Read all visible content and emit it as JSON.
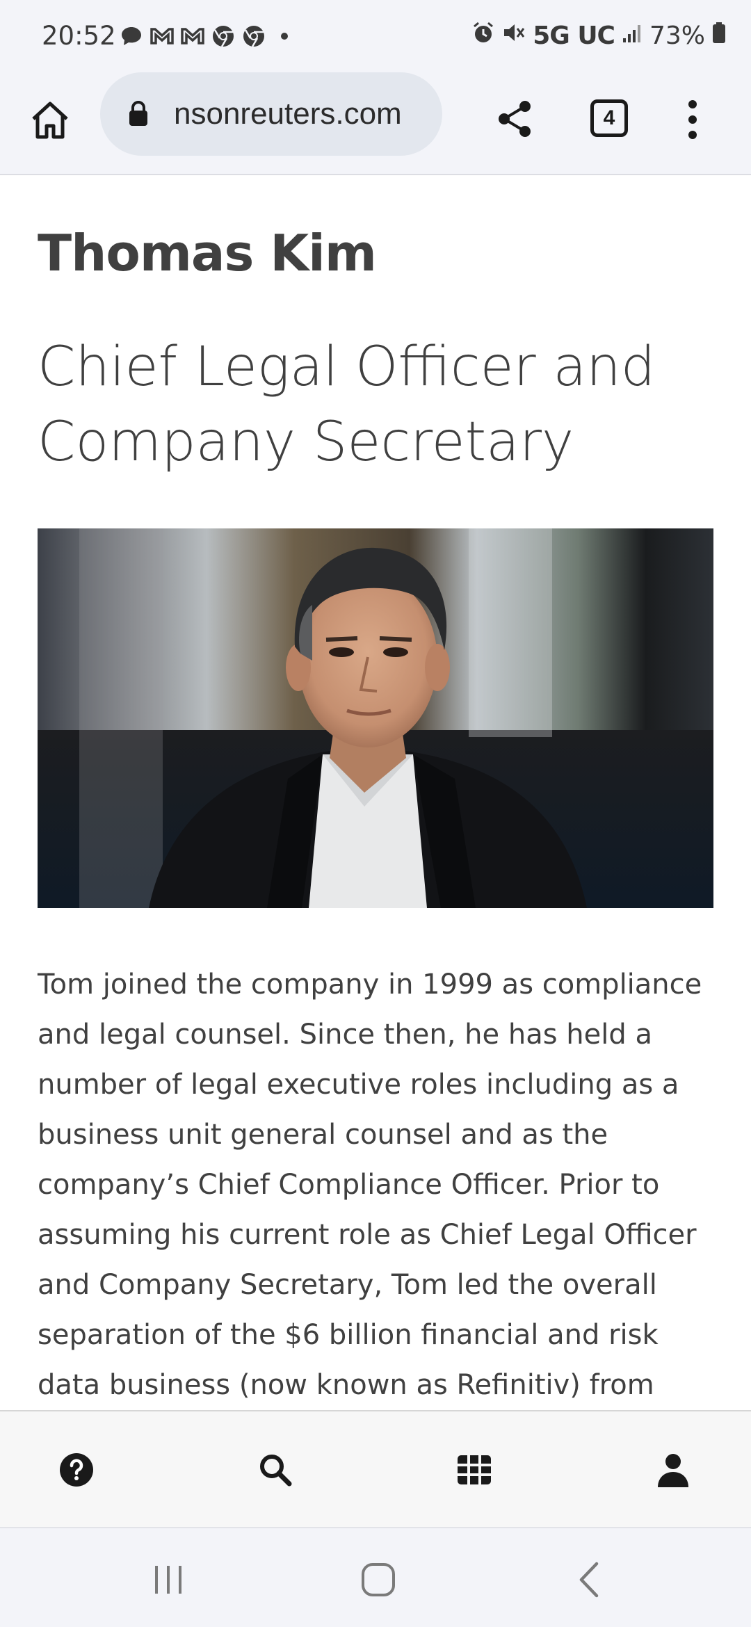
{
  "status_bar": {
    "time": "20:52",
    "network": "5G UC",
    "battery": "73%",
    "left_icons": [
      "chat-icon",
      "gmail-icon",
      "gmail-icon",
      "chrome-icon",
      "chrome-icon",
      "dot-icon"
    ],
    "right_icons": [
      "alarm-icon",
      "mute-icon",
      "signal-icon",
      "battery-icon"
    ]
  },
  "browser": {
    "url": "nsonreuters.com",
    "tab_count": "4"
  },
  "profile": {
    "name": "Thomas Kim",
    "title": "Chief Legal Officer and Company Secretary",
    "bio": "Tom joined the company in 1999 as compliance and legal counsel. Since then, he has held a number of legal executive roles including as a business unit general counsel and as the company’s Chief Compliance Officer. Prior to assuming his current role as Chief Legal Officer and Company Secretary, Tom led the overall separation of the $6 billion financial and risk data business (now known as Refinitiv) from"
  },
  "bottom_nav": {
    "items": [
      "help-icon",
      "search-icon",
      "grid-icon",
      "account-icon"
    ]
  },
  "colors": {
    "text": "#404040",
    "bar_bg": "#f3f4f9",
    "url_pill": "#e3e7ee"
  }
}
